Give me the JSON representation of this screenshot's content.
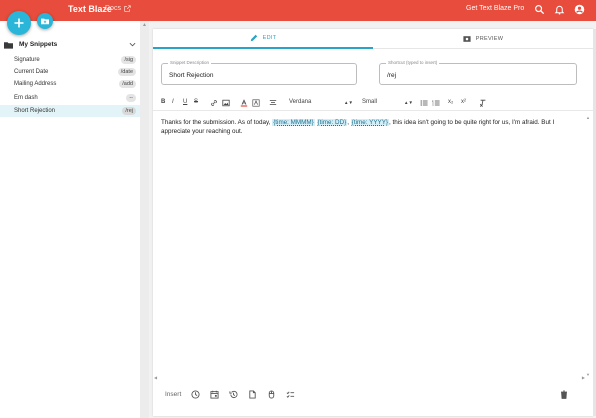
{
  "app": {
    "brand": "Text Blaze",
    "docs_label": "Docs",
    "get_pro_label": "Get Text Blaze Pro"
  },
  "sidebar": {
    "folder": {
      "label": "My Snippets",
      "expanded": true
    },
    "items": [
      {
        "label": "Signature",
        "shortcut": "/sig",
        "active": false
      },
      {
        "label": "Current Date",
        "shortcut": "/date",
        "active": false
      },
      {
        "label": "Mailing Address",
        "shortcut": "/add",
        "active": false
      },
      {
        "label": "Em dash",
        "shortcut": "--",
        "active": false
      },
      {
        "label": "Short Rejection",
        "shortcut": "/rej",
        "active": true
      }
    ]
  },
  "tabs": {
    "edit": "EDIT",
    "preview": "PREVIEW",
    "active": "edit"
  },
  "fields": {
    "description": {
      "label": "Snippet Description",
      "value": "Short Rejection"
    },
    "shortcut": {
      "label": "Shortcut (typed to insert)",
      "value": "/rej"
    }
  },
  "toolbar": {
    "bold": "B",
    "italic": "I",
    "underline": "U",
    "strike": "S",
    "font": "Verdana",
    "size": "Small",
    "subscript": "x₂",
    "superscript": "x²"
  },
  "editor": {
    "text_1": "Thanks for the submission. As of today, ",
    "chip_1": "{time: MMMM}",
    "text_2": " ",
    "chip_2": "{time: DD}",
    "text_3": ", ",
    "chip_3": "{time: YYYY}",
    "text_4": ", this idea isn't going to be quite right for us, I'm afraid. But I appreciate your reaching out."
  },
  "bottom": {
    "insert_label": "Insert"
  },
  "colors": {
    "topbar": "#e74c3c",
    "accent": "#29b6d8",
    "chip_bg": "#d4eef7",
    "active_row": "#e3f4f8"
  }
}
